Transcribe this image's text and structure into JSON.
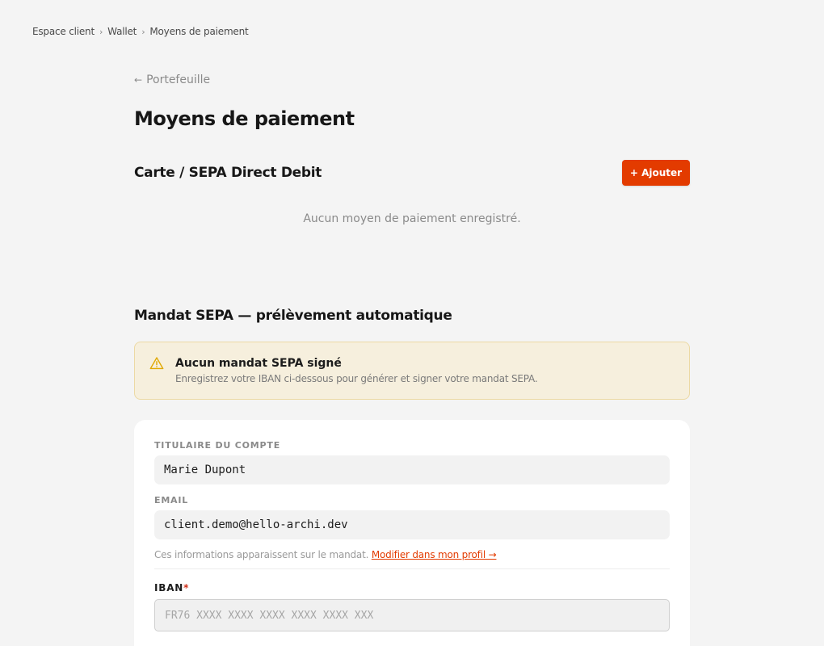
{
  "breadcrumb": {
    "items": [
      "Espace client",
      "Wallet",
      "Moyens de paiement"
    ],
    "separator": "›"
  },
  "back_link": {
    "arrow": "←",
    "label": "Portefeuille"
  },
  "page_title": "Moyens de paiement",
  "payment_section": {
    "title": "Carte / SEPA Direct Debit",
    "add_button_label": "+ Ajouter",
    "empty_message": "Aucun moyen de paiement enregistré."
  },
  "mandate_section": {
    "title": "Mandat SEPA — prélèvement automatique",
    "alert": {
      "icon": "warning-triangle-icon",
      "title": "Aucun mandat SEPA signé",
      "text": "Enregistrez votre IBAN ci-dessous pour générer et signer votre mandat SEPA."
    },
    "form": {
      "holder_label": "TITULAIRE DU COMPTE",
      "holder_value": "Marie Dupont",
      "email_label": "EMAIL",
      "email_value": "client.demo@hello-archi.dev",
      "helper_text": "Ces informations apparaissent sur le mandat.",
      "helper_link": "Modifier dans mon profil →",
      "iban_label": "IBAN",
      "iban_required_marker": "*",
      "iban_placeholder": "FR76 XXXX XXXX XXXX XXXX XXXX XXX"
    }
  },
  "colors": {
    "accent": "#e33b00",
    "alert_background": "#f6efdd",
    "alert_icon": "#e0a800",
    "page_background": "#f4f4f4"
  }
}
